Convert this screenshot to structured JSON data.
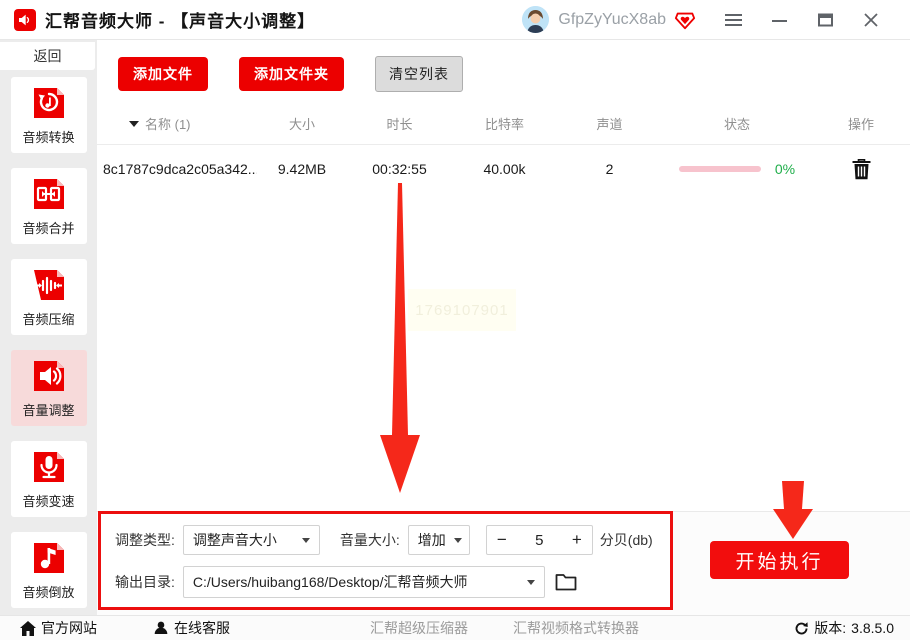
{
  "title_bar": {
    "app_title": "汇帮音频大师 - 【声音大小调整】",
    "username": "GfpZyYucX8ab"
  },
  "sidebar": {
    "back_label": "返回",
    "items": [
      {
        "label": "音频转换"
      },
      {
        "label": "音频合并"
      },
      {
        "label": "音频压缩"
      },
      {
        "label": "音量调整"
      },
      {
        "label": "音频变速"
      },
      {
        "label": "音频倒放"
      }
    ]
  },
  "toolbar": {
    "add_file": "添加文件",
    "add_folder": "添加文件夹",
    "clear_list": "清空列表"
  },
  "table": {
    "headers": {
      "name": "名称 (1)",
      "size": "大小",
      "duration": "时长",
      "bitrate": "比特率",
      "channels": "声道",
      "status": "状态",
      "actions": "操作"
    },
    "rows": [
      {
        "name": "8c1787c9dca2c05a342...",
        "size": "9.42MB",
        "duration": "00:32:55",
        "bitrate": "40.00k",
        "channels": "2",
        "progress_percent": 0,
        "progress": "0%"
      }
    ]
  },
  "watermark": "1769107901",
  "settings": {
    "adjust_type_label": "调整类型:",
    "adjust_type_value": "调整声音大小",
    "volume_label": "音量大小:",
    "volume_mode": "增加",
    "minus": "−",
    "volume_value": "5",
    "plus": "+",
    "unit": "分贝(db)",
    "output_label": "输出目录:",
    "output_path": "C:/Users/huibang168/Desktop/汇帮音频大师"
  },
  "actions": {
    "start": "开始执行"
  },
  "footer": {
    "official_site": "官方网站",
    "online_service": "在线客服",
    "link_compressor": "汇帮超级压缩器",
    "link_video_converter": "汇帮视频格式转换器",
    "version_label": "版本:",
    "version": "3.8.5.0"
  },
  "colors": {
    "accent_red": "#ec0000",
    "panel_border_red": "#ec0f0f",
    "arrow_red": "#f5281a",
    "selected_pink": "#f7dada",
    "progress_pink": "#f7c3cd",
    "percent_green": "#1fae4a"
  }
}
